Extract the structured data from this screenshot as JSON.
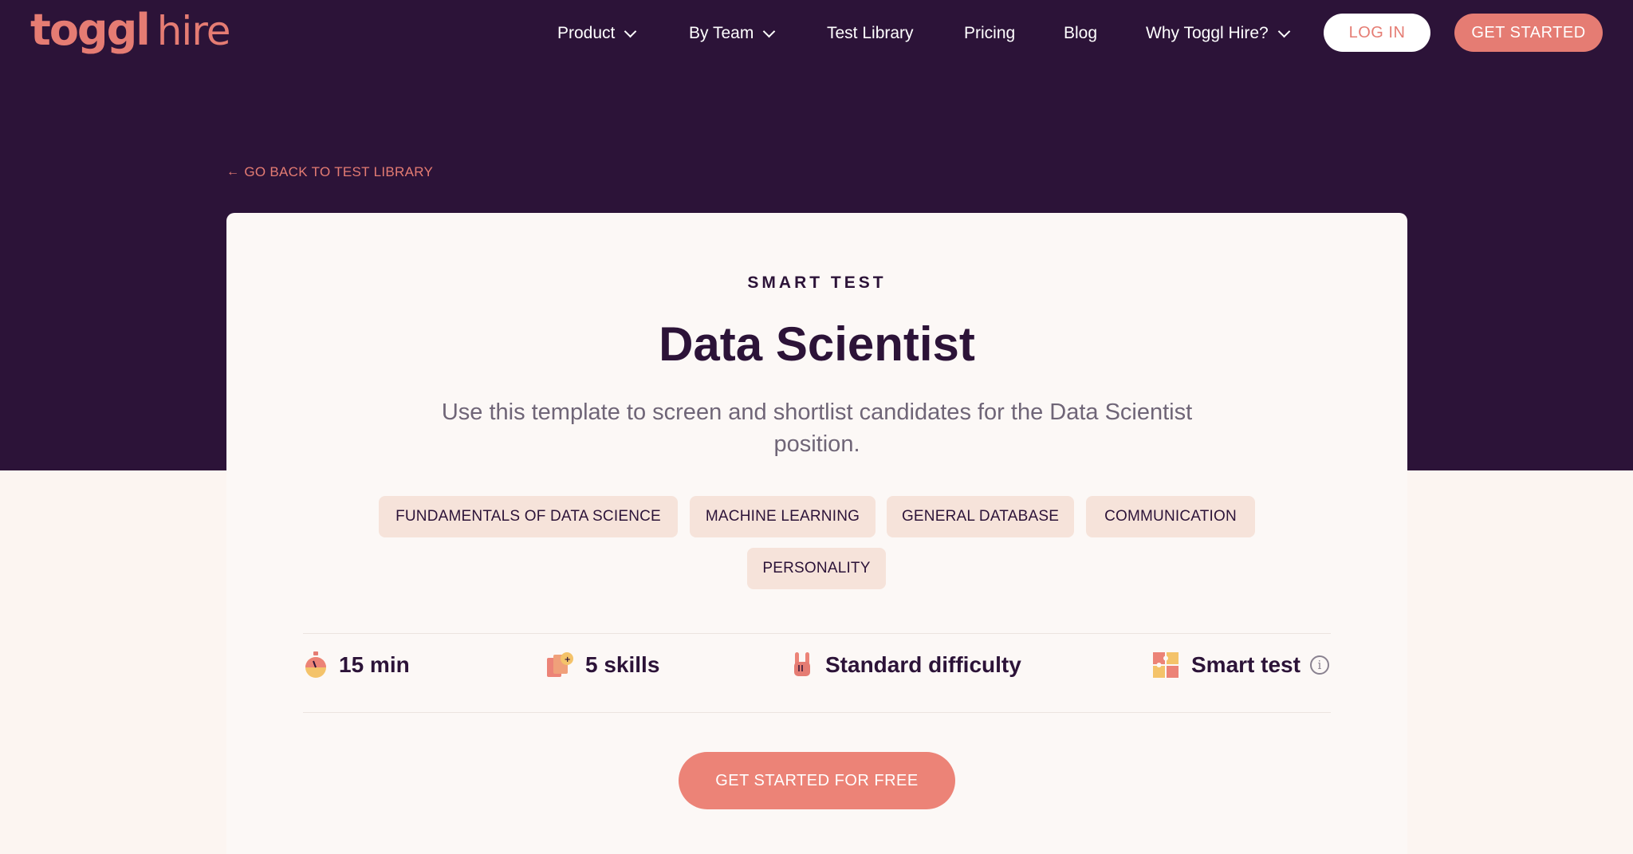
{
  "brand": {
    "logo_primary": "toggl",
    "logo_secondary": "hire",
    "accent_color": "#e57c73",
    "dark_color": "#2c1338"
  },
  "nav": {
    "items": [
      {
        "label": "Product",
        "has_dropdown": true
      },
      {
        "label": "By Team",
        "has_dropdown": true
      },
      {
        "label": "Test Library",
        "has_dropdown": false
      },
      {
        "label": "Pricing",
        "has_dropdown": false
      },
      {
        "label": "Blog",
        "has_dropdown": false
      },
      {
        "label": "Why Toggl Hire?",
        "has_dropdown": true
      }
    ],
    "login_label": "LOG IN",
    "get_started_label": "GET STARTED"
  },
  "back_link": {
    "icon": "arrow-left-icon",
    "label": "GO BACK TO TEST LIBRARY"
  },
  "test": {
    "eyebrow": "SMART TEST",
    "title": "Data Scientist",
    "description": "Use this template to screen and shortlist candidates for the Data Scientist position.",
    "skills": [
      "FUNDAMENTALS OF DATA SCIENCE",
      "MACHINE LEARNING",
      "GENERAL DATABASE",
      "COMMUNICATION",
      "PERSONALITY"
    ],
    "stats": [
      {
        "icon": "stopwatch-icon",
        "label": "15 min"
      },
      {
        "icon": "skills-cards-icon",
        "label": "5 skills"
      },
      {
        "icon": "rock-hand-icon",
        "label": "Standard difficulty"
      },
      {
        "icon": "puzzle-icon",
        "label": "Smart test",
        "info_icon": "info-icon"
      }
    ],
    "cta_label": "GET STARTED FOR FREE"
  }
}
